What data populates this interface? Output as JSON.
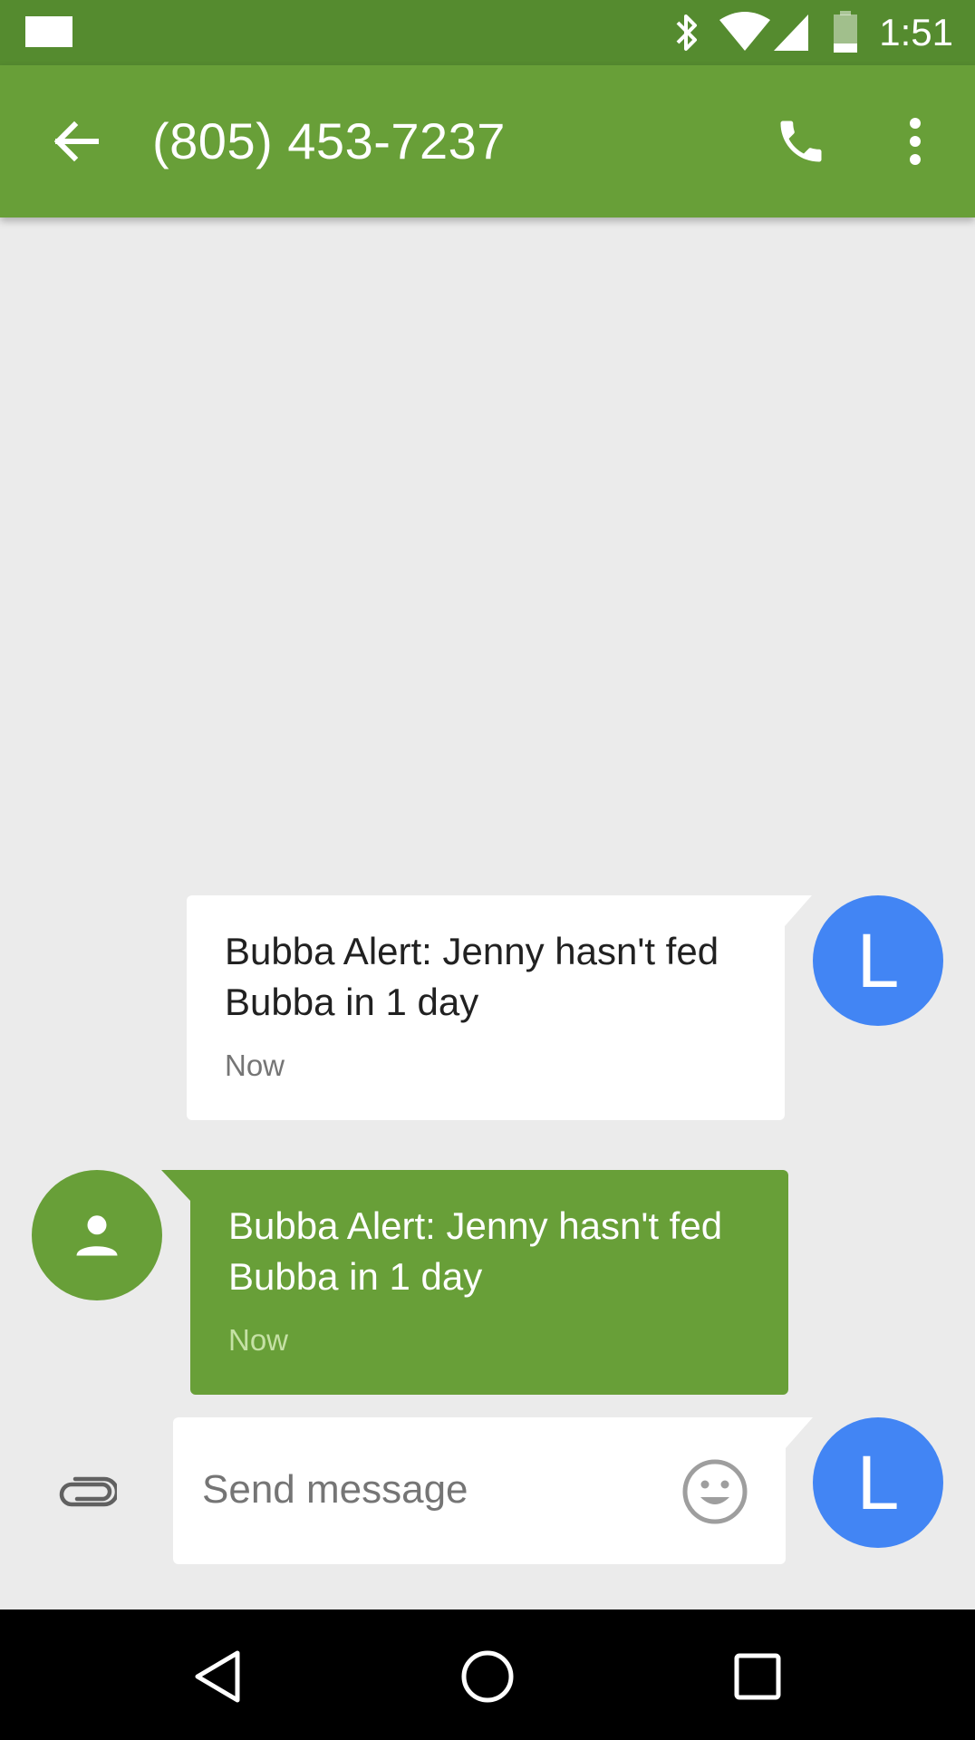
{
  "status_bar": {
    "time": "1:51",
    "icons": [
      "notification-icon",
      "bluetooth-icon",
      "wifi-icon",
      "cell-signal-icon",
      "battery-icon"
    ]
  },
  "app_bar": {
    "title": "(805) 453-7237",
    "color": "#689f38",
    "icons": [
      "back-arrow-icon",
      "phone-icon",
      "more-vert-icon"
    ]
  },
  "messages": [
    {
      "direction": "incoming",
      "text": "Bubba Alert: Jenny hasn't fed Bubba in 1 day",
      "time": "Now",
      "avatar_letter": "L",
      "avatar_color": "#4285f4"
    },
    {
      "direction": "outgoing",
      "text": "Bubba Alert: Jenny hasn't fed Bubba in 1 day",
      "time": "Now",
      "avatar_icon": "person-icon",
      "bubble_color": "#689f38"
    }
  ],
  "compose": {
    "placeholder": "Send message",
    "value": "",
    "avatar_letter": "L",
    "icons": [
      "paperclip-icon",
      "emoji-icon"
    ]
  },
  "nav_bar": {
    "icons": [
      "back-triangle-icon",
      "home-circle-icon",
      "recents-square-icon"
    ]
  }
}
